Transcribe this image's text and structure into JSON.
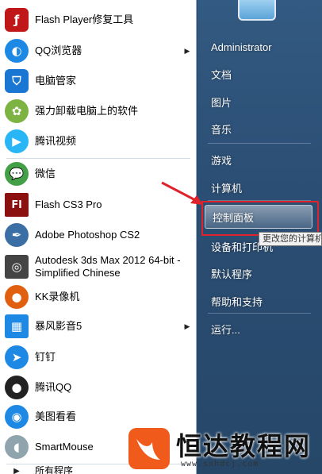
{
  "programs": [
    {
      "label": "Flash Player修复工具",
      "icon": "flash-player-repair-icon",
      "color": "#c01818"
    },
    {
      "label": "QQ浏览器",
      "icon": "qq-browser-icon",
      "color": "#1e88e5",
      "submenu": true
    },
    {
      "label": "电脑管家",
      "icon": "pc-manager-shield-icon",
      "color": "#1976d2"
    },
    {
      "label": "强力卸载电脑上的软件",
      "icon": "uninstaller-clover-icon",
      "color": "#7cb342"
    },
    {
      "label": "腾讯视频",
      "icon": "tencent-video-icon",
      "color": "#29b6f6"
    },
    {
      "label": "微信",
      "icon": "wechat-icon",
      "color": "#43a047"
    },
    {
      "label": "Flash CS3 Pro",
      "icon": "flash-cs3-icon",
      "color": "#8b1010"
    },
    {
      "label": "Adobe Photoshop CS2",
      "icon": "photoshop-feather-icon",
      "color": "#3a6ea5"
    },
    {
      "label": "Autodesk 3ds Max 2012 64-bit - Simplified Chinese",
      "icon": "3ds-max-icon",
      "color": "#444444"
    },
    {
      "label": "KK录像机",
      "icon": "kk-recorder-icon",
      "color": "#e06010"
    },
    {
      "label": "暴风影音5",
      "icon": "baofeng-player-icon",
      "color": "#1e88e5",
      "submenu": true
    },
    {
      "label": "钉钉",
      "icon": "dingtalk-icon",
      "color": "#1e88e5"
    },
    {
      "label": "腾讯QQ",
      "icon": "qq-penguin-icon",
      "color": "#222222"
    },
    {
      "label": "美图看看",
      "icon": "meitu-viewer-icon",
      "color": "#1e88e5"
    },
    {
      "label": "SmartMouse",
      "icon": "smartmouse-icon",
      "color": "#90a4ae"
    }
  ],
  "all_programs_label": "所有程序",
  "right_items": [
    {
      "label": "Administrator"
    },
    {
      "label": "文档"
    },
    {
      "label": "图片"
    },
    {
      "label": "音乐"
    },
    {
      "label": "游戏"
    },
    {
      "label": "计算机"
    },
    {
      "label": "控制面板"
    },
    {
      "label": "设备和打印机"
    },
    {
      "label": "默认程序"
    },
    {
      "label": "帮助和支持"
    },
    {
      "label": "运行..."
    }
  ],
  "tooltip": "更改您的计算机",
  "watermark": {
    "title": "恒达教程网",
    "url": "www.sxhdcj.com"
  },
  "colors": {
    "highlight_border": "#e0222b",
    "panel_dark": "#2b4e74"
  }
}
